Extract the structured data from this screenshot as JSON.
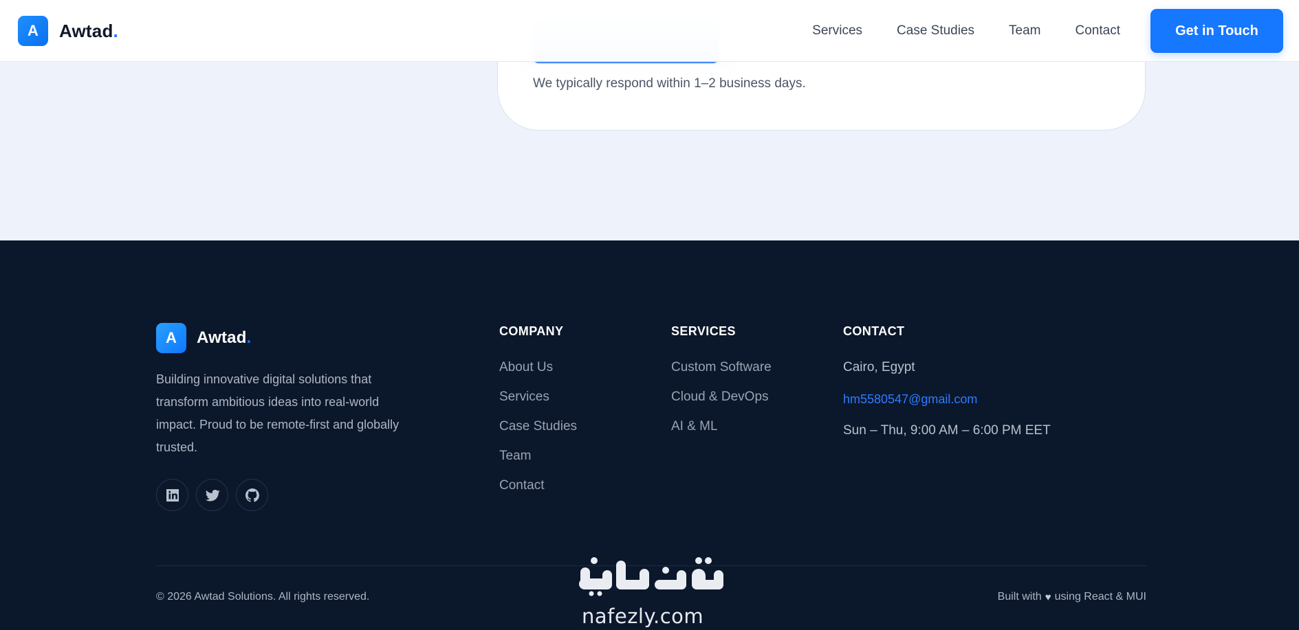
{
  "header": {
    "logo_letter": "A",
    "brand_name": "Awtad",
    "brand_dot": ".",
    "nav": [
      "Services",
      "Case Studies",
      "Team",
      "Contact"
    ],
    "cta_label": "Get in Touch"
  },
  "form": {
    "response_note": "We typically respond within 1–2 business days."
  },
  "footer": {
    "logo_letter": "A",
    "brand_name": "Awtad",
    "brand_dot": ".",
    "description": "Building innovative digital solutions that transform ambitious ideas into real-world impact. Proud to be remote-first and globally trusted.",
    "socials": [
      "linkedin-icon",
      "twitter-icon",
      "github-icon"
    ],
    "company": {
      "title": "COMPANY",
      "links": [
        "About Us",
        "Services",
        "Case Studies",
        "Team",
        "Contact"
      ]
    },
    "services": {
      "title": "SERVICES",
      "links": [
        "Custom Software",
        "Cloud & DevOps",
        "AI & ML"
      ]
    },
    "contact": {
      "title": "CONTACT",
      "location": "Cairo, Egypt",
      "email": "hm5580547@gmail.com",
      "hours": "Sun – Thu, 9:00 AM – 6:00 PM EET"
    },
    "copyright": "© 2026 Awtad Solutions. All rights reserved.",
    "built_prefix": "Built with",
    "built_suffix": "using React & MUI"
  },
  "watermark": {
    "arabic": "نفذلي",
    "latin": "nafezly.com"
  },
  "colors": {
    "accent": "#1677ff",
    "footer_bg": "#0b172a",
    "page_bg": "#eef3fb"
  }
}
